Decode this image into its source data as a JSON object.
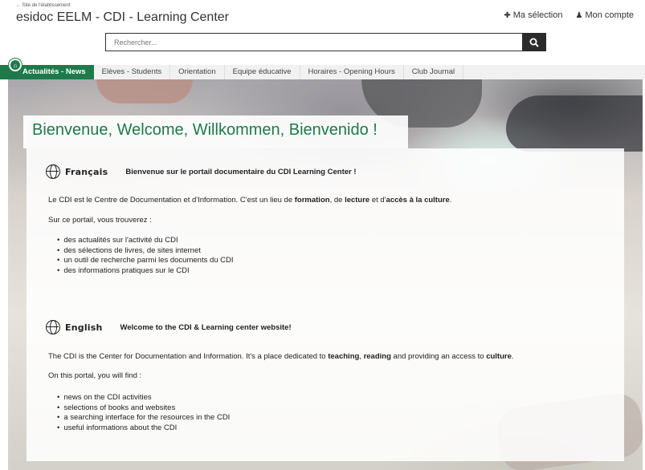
{
  "header": {
    "back_link": "← Site de l'établissement",
    "site_title": "esidoc EELM - CDI - Learning Center",
    "my_selection": "Ma sélection",
    "my_account": "Mon compte"
  },
  "search": {
    "placeholder": "Rechercher..."
  },
  "nav": {
    "items": [
      {
        "label": "Actualités - News",
        "active": true
      },
      {
        "label": "Elèves - Students"
      },
      {
        "label": "Orientation"
      },
      {
        "label": "Equipe éducative"
      },
      {
        "label": "Horaires - Opening Hours"
      },
      {
        "label": "Club Journal"
      }
    ]
  },
  "hero": {
    "welcome": "Bienvenue, Welcome, Willkommen, Bienvenido !"
  },
  "french": {
    "lang": "Français",
    "heading": "Bienvenue sur le portail documentaire du CDI Learning Center !",
    "intro_1": "Le CDI est le Centre de Documentation et d'Information. C'est un lieu de ",
    "intro_b1": "formation",
    "intro_2": ", de ",
    "intro_b2": "lecture",
    "intro_3": " et d'",
    "intro_b3": "accès à la culture",
    "intro_4": ".",
    "lead": "Sur ce portail, vous trouverez :",
    "list": [
      "des actualités sur l'activité du CDI",
      "des sélections de livres, de sites internet",
      "un outil de recherche parmi les documents du CDI",
      "des informations pratiques sur le CDI"
    ]
  },
  "english": {
    "lang": "English",
    "heading": "Welcome to the CDI & Learning center website!",
    "intro_1": "The CDI is the Center for Documentation and Information. It's a place dedicated to ",
    "intro_b1": "teaching",
    "intro_2": ", ",
    "intro_b2": "reading",
    "intro_3": " and providing an access to ",
    "intro_b3": "culture",
    "intro_4": ".",
    "lead": "On this portal, you will find :",
    "list": [
      "news on the CDI activities",
      "selections of books and websites",
      "a searching interface for the resources in the CDI",
      "useful informations about the CDI"
    ]
  },
  "colors": {
    "accent": "#1e7a4a",
    "nav_bg": "#f1f1f1",
    "search_button": "#2b2b2b"
  },
  "icons": {
    "selection": "pin-icon",
    "account": "user-icon",
    "search": "search-icon",
    "home": "home-icon",
    "language": "globe-icon"
  }
}
